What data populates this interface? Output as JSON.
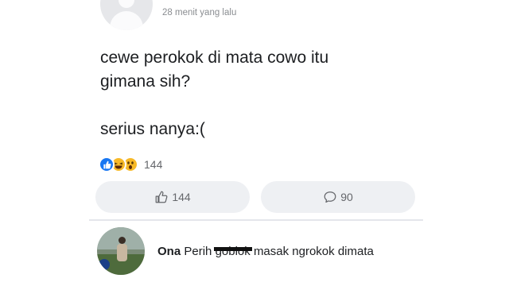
{
  "post": {
    "timestamp": "28 menit yang lalu",
    "text": "cewe perokok di mata cowo itu\ngimana sih?\n\nserius nanya:(",
    "reactions": {
      "icons": [
        "like-icon",
        "haha-icon",
        "wow-icon"
      ],
      "count": "144"
    }
  },
  "actions": {
    "like_count": "144",
    "comment_count": "90"
  },
  "comment": {
    "author": "Ona",
    "text_before": "Perih",
    "censored_word": "goblok",
    "text_after": "masak ngrokok dimata"
  },
  "colors": {
    "like_blue": "#1877f2",
    "emoji_yellow": "#f7b928",
    "button_bg": "#eef0f3",
    "muted_text": "#65676b"
  }
}
